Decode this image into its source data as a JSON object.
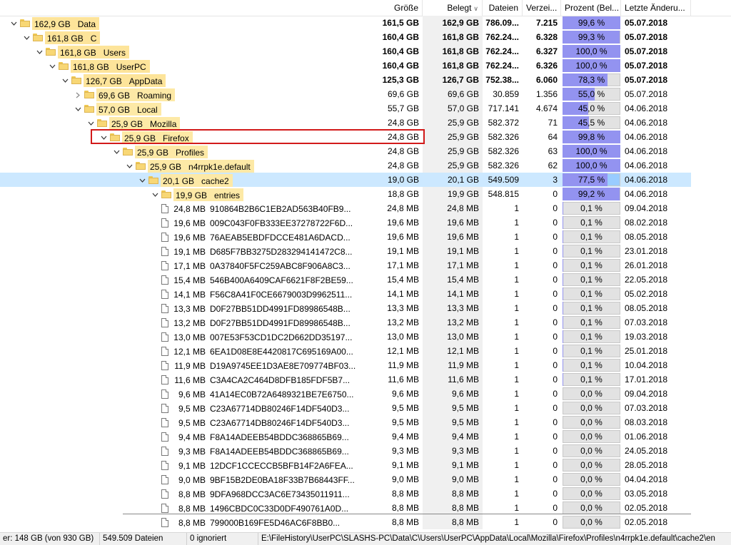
{
  "header": {
    "columns": [
      "Größe",
      "Belegt",
      "Dateien",
      "Verzei...",
      "Prozent (Bel...",
      "Letzte Änderu..."
    ],
    "sort_icon": "chevron-down-icon"
  },
  "colors": {
    "selection": "#cce8ff",
    "size_bar": "#fde9a6",
    "percent_fill": "#9393f0",
    "highlight": "#d21a1a"
  },
  "rows": [
    {
      "level": 0,
      "type": "folder",
      "expand": "open",
      "bold": true,
      "size": "162,9 GB",
      "name": "Data",
      "groesse": "161,5 GB",
      "belegt": "162,9 GB",
      "dateien": "786.09...",
      "verz": "7.215",
      "prozent": "99,6 %",
      "pct": 99.6,
      "date": "05.07.2018"
    },
    {
      "level": 1,
      "type": "folder",
      "expand": "open",
      "bold": true,
      "size": "161,8 GB",
      "name": "C",
      "groesse": "160,4 GB",
      "belegt": "161,8 GB",
      "dateien": "762.24...",
      "verz": "6.328",
      "prozent": "99,3 %",
      "pct": 99.3,
      "date": "05.07.2018"
    },
    {
      "level": 2,
      "type": "folder",
      "expand": "open",
      "bold": true,
      "size": "161,8 GB",
      "name": "Users",
      "groesse": "160,4 GB",
      "belegt": "161,8 GB",
      "dateien": "762.24...",
      "verz": "6.327",
      "prozent": "100,0 %",
      "pct": 100,
      "date": "05.07.2018"
    },
    {
      "level": 3,
      "type": "folder",
      "expand": "open",
      "bold": true,
      "size": "161,8 GB",
      "name": "UserPC",
      "groesse": "160,4 GB",
      "belegt": "161,8 GB",
      "dateien": "762.24...",
      "verz": "6.326",
      "prozent": "100,0 %",
      "pct": 100,
      "date": "05.07.2018"
    },
    {
      "level": 4,
      "type": "folder",
      "expand": "open",
      "bold": true,
      "size": "126,7 GB",
      "name": "AppData",
      "groesse": "125,3 GB",
      "belegt": "126,7 GB",
      "dateien": "752.38...",
      "verz": "6.060",
      "prozent": "78,3 %",
      "pct": 78.3,
      "date": "05.07.2018"
    },
    {
      "level": 5,
      "type": "folder",
      "expand": "closed",
      "size": "69,6 GB",
      "name": "Roaming",
      "groesse": "69,6 GB",
      "belegt": "69,6 GB",
      "dateien": "30.859",
      "verz": "1.356",
      "prozent": "55,0 %",
      "pct": 55,
      "date": "05.07.2018"
    },
    {
      "level": 5,
      "type": "folder",
      "expand": "open",
      "size": "57,0 GB",
      "name": "Local",
      "groesse": "55,7 GB",
      "belegt": "57,0 GB",
      "dateien": "717.141",
      "verz": "4.674",
      "prozent": "45,0 %",
      "pct": 45,
      "date": "04.06.2018"
    },
    {
      "level": 6,
      "type": "folder",
      "expand": "open",
      "size": "25,9 GB",
      "name": "Mozilla",
      "groesse": "24,8 GB",
      "belegt": "25,9 GB",
      "dateien": "582.372",
      "verz": "71",
      "prozent": "45,5 %",
      "pct": 45.5,
      "date": "04.06.2018"
    },
    {
      "level": 7,
      "type": "folder",
      "expand": "open",
      "size": "25,9 GB",
      "name": "Firefox",
      "groesse": "24,8 GB",
      "belegt": "25,9 GB",
      "dateien": "582.326",
      "verz": "64",
      "prozent": "99,8 %",
      "pct": 99.8,
      "date": "04.06.2018"
    },
    {
      "level": 8,
      "type": "folder",
      "expand": "open",
      "size": "25,9 GB",
      "name": "Profiles",
      "groesse": "24,8 GB",
      "belegt": "25,9 GB",
      "dateien": "582.326",
      "verz": "63",
      "prozent": "100,0 %",
      "pct": 100,
      "date": "04.06.2018"
    },
    {
      "level": 9,
      "type": "folder",
      "expand": "open",
      "size": "25,9 GB",
      "name": "n4rrpk1e.default",
      "groesse": "24,8 GB",
      "belegt": "25,9 GB",
      "dateien": "582.326",
      "verz": "62",
      "prozent": "100,0 %",
      "pct": 100,
      "date": "04.06.2018"
    },
    {
      "level": 10,
      "type": "folder",
      "expand": "open",
      "selected": true,
      "size": "20,1 GB",
      "name": "cache2",
      "groesse": "19,0 GB",
      "belegt": "20,1 GB",
      "dateien": "549.509",
      "verz": "3",
      "prozent": "77,5 %",
      "pct": 77.5,
      "date": "04.06.2018"
    },
    {
      "level": 11,
      "type": "folder",
      "expand": "open",
      "size": "19,9 GB",
      "name": "entries",
      "groesse": "18,8 GB",
      "belegt": "19,9 GB",
      "dateien": "548.815",
      "verz": "0",
      "prozent": "99,2 %",
      "pct": 99.2,
      "date": "04.06.2018"
    },
    {
      "level": 12,
      "type": "file",
      "size": "24,8 MB",
      "name": "910864B2B6C1EB2AD563B40FB9...",
      "groesse": "24,8 MB",
      "belegt": "24,8 MB",
      "dateien": "1",
      "verz": "0",
      "prozent": "0,1 %",
      "pct": 0.1,
      "date": "09.04.2018"
    },
    {
      "level": 12,
      "type": "file",
      "size": "19,6 MB",
      "name": "009C043F0FB333EE37278722F6D...",
      "groesse": "19,6 MB",
      "belegt": "19,6 MB",
      "dateien": "1",
      "verz": "0",
      "prozent": "0,1 %",
      "pct": 0.1,
      "date": "08.02.2018"
    },
    {
      "level": 12,
      "type": "file",
      "size": "19,6 MB",
      "name": "76AEAB5EBDFDCCE481A6DACD...",
      "groesse": "19,6 MB",
      "belegt": "19,6 MB",
      "dateien": "1",
      "verz": "0",
      "prozent": "0,1 %",
      "pct": 0.1,
      "date": "08.05.2018"
    },
    {
      "level": 12,
      "type": "file",
      "size": "19,1 MB",
      "name": "D685F7BB3275D283294141472C8...",
      "groesse": "19,1 MB",
      "belegt": "19,1 MB",
      "dateien": "1",
      "verz": "0",
      "prozent": "0,1 %",
      "pct": 0.1,
      "date": "23.01.2018"
    },
    {
      "level": 12,
      "type": "file",
      "size": "17,1 MB",
      "name": "0A37840F5FC259ABC8F906A8C3...",
      "groesse": "17,1 MB",
      "belegt": "17,1 MB",
      "dateien": "1",
      "verz": "0",
      "prozent": "0,1 %",
      "pct": 0.1,
      "date": "26.01.2018"
    },
    {
      "level": 12,
      "type": "file",
      "size": "15,4 MB",
      "name": "546B400A6409CAF6621F8F2BE59...",
      "groesse": "15,4 MB",
      "belegt": "15,4 MB",
      "dateien": "1",
      "verz": "0",
      "prozent": "0,1 %",
      "pct": 0.1,
      "date": "22.05.2018"
    },
    {
      "level": 12,
      "type": "file",
      "size": "14,1 MB",
      "name": "F56C8A41F0CE6679003D9962511...",
      "groesse": "14,1 MB",
      "belegt": "14,1 MB",
      "dateien": "1",
      "verz": "0",
      "prozent": "0,1 %",
      "pct": 0.1,
      "date": "05.02.2018"
    },
    {
      "level": 12,
      "type": "file",
      "size": "13,3 MB",
      "name": "D0F27BB51DD4991FD89986548B...",
      "groesse": "13,3 MB",
      "belegt": "13,3 MB",
      "dateien": "1",
      "verz": "0",
      "prozent": "0,1 %",
      "pct": 0.1,
      "date": "08.05.2018"
    },
    {
      "level": 12,
      "type": "file",
      "size": "13,2 MB",
      "name": "D0F27BB51DD4991FD89986548B...",
      "groesse": "13,2 MB",
      "belegt": "13,2 MB",
      "dateien": "1",
      "verz": "0",
      "prozent": "0,1 %",
      "pct": 0.1,
      "date": "07.03.2018"
    },
    {
      "level": 12,
      "type": "file",
      "size": "13,0 MB",
      "name": "007E53F53CD1DC2D662DD35197...",
      "groesse": "13,0 MB",
      "belegt": "13,0 MB",
      "dateien": "1",
      "verz": "0",
      "prozent": "0,1 %",
      "pct": 0.1,
      "date": "19.03.2018"
    },
    {
      "level": 12,
      "type": "file",
      "size": "12,1 MB",
      "name": "6EA1D08E8E4420817C695169A00...",
      "groesse": "12,1 MB",
      "belegt": "12,1 MB",
      "dateien": "1",
      "verz": "0",
      "prozent": "0,1 %",
      "pct": 0.1,
      "date": "25.01.2018"
    },
    {
      "level": 12,
      "type": "file",
      "size": "11,9 MB",
      "name": "D19A9745EE1D3AE8E709774BF03...",
      "groesse": "11,9 MB",
      "belegt": "11,9 MB",
      "dateien": "1",
      "verz": "0",
      "prozent": "0,1 %",
      "pct": 0.1,
      "date": "10.04.2018"
    },
    {
      "level": 12,
      "type": "file",
      "size": "11,6 MB",
      "name": "C3A4CA2C464D8DFB185FDF5B7...",
      "groesse": "11,6 MB",
      "belegt": "11,6 MB",
      "dateien": "1",
      "verz": "0",
      "prozent": "0,1 %",
      "pct": 0.1,
      "date": "17.01.2018"
    },
    {
      "level": 12,
      "type": "file",
      "size": "9,6 MB",
      "name": "41A14EC0B72A6489321BE7E6750...",
      "groesse": "9,6 MB",
      "belegt": "9,6 MB",
      "dateien": "1",
      "verz": "0",
      "prozent": "0,0 %",
      "pct": 0,
      "date": "09.04.2018"
    },
    {
      "level": 12,
      "type": "file",
      "size": "9,5 MB",
      "name": "C23A67714DB80246F14DF540D3...",
      "groesse": "9,5 MB",
      "belegt": "9,5 MB",
      "dateien": "1",
      "verz": "0",
      "prozent": "0,0 %",
      "pct": 0,
      "date": "07.03.2018"
    },
    {
      "level": 12,
      "type": "file",
      "size": "9,5 MB",
      "name": "C23A67714DB80246F14DF540D3...",
      "groesse": "9,5 MB",
      "belegt": "9,5 MB",
      "dateien": "1",
      "verz": "0",
      "prozent": "0,0 %",
      "pct": 0,
      "date": "08.03.2018"
    },
    {
      "level": 12,
      "type": "file",
      "size": "9,4 MB",
      "name": "F8A14ADEEB54BDDC368865B69...",
      "groesse": "9,4 MB",
      "belegt": "9,4 MB",
      "dateien": "1",
      "verz": "0",
      "prozent": "0,0 %",
      "pct": 0,
      "date": "01.06.2018"
    },
    {
      "level": 12,
      "type": "file",
      "size": "9,3 MB",
      "name": "F8A14ADEEB54BDDC368865B69...",
      "groesse": "9,3 MB",
      "belegt": "9,3 MB",
      "dateien": "1",
      "verz": "0",
      "prozent": "0,0 %",
      "pct": 0,
      "date": "24.05.2018"
    },
    {
      "level": 12,
      "type": "file",
      "size": "9,1 MB",
      "name": "12DCF1CCECCB5BFB14F2A6FEA...",
      "groesse": "9,1 MB",
      "belegt": "9,1 MB",
      "dateien": "1",
      "verz": "0",
      "prozent": "0,0 %",
      "pct": 0,
      "date": "28.05.2018"
    },
    {
      "level": 12,
      "type": "file",
      "size": "9,0 MB",
      "name": "9BF15B2DE0BA18F33B7B68443FF...",
      "groesse": "9,0 MB",
      "belegt": "9,0 MB",
      "dateien": "1",
      "verz": "0",
      "prozent": "0,0 %",
      "pct": 0,
      "date": "04.04.2018"
    },
    {
      "level": 12,
      "type": "file",
      "size": "8,8 MB",
      "name": "9DFA968DCC3AC6E73435011911...",
      "groesse": "8,8 MB",
      "belegt": "8,8 MB",
      "dateien": "1",
      "verz": "0",
      "prozent": "0,0 %",
      "pct": 0,
      "date": "03.05.2018"
    },
    {
      "level": 12,
      "type": "file",
      "size": "8,8 MB",
      "name": "1496CBDC0C33D0DF490761A0D...",
      "groesse": "8,8 MB",
      "belegt": "8,8 MB",
      "dateien": "1",
      "verz": "0",
      "prozent": "0,0 %",
      "pct": 0,
      "date": "02.05.2018"
    },
    {
      "level": 12,
      "type": "file",
      "size": "8,8 MB",
      "name": "799000B169FE5D46AC6F8BB0...",
      "groesse": "8,8 MB",
      "belegt": "8,8 MB",
      "dateien": "1",
      "verz": "0",
      "prozent": "0,0 %",
      "pct": 0,
      "date": "02.05.2018"
    }
  ],
  "status": {
    "space": "er: 148 GB  (von 930 GB)",
    "files": "549.509  Dateien",
    "ignored": "0 ignoriert",
    "path": "E:\\FileHistory\\UserPC\\SLASHS-PC\\Data\\C\\Users\\UserPC\\AppData\\Local\\Mozilla\\Firefox\\Profiles\\n4rrpk1e.default\\cache2\\en"
  }
}
